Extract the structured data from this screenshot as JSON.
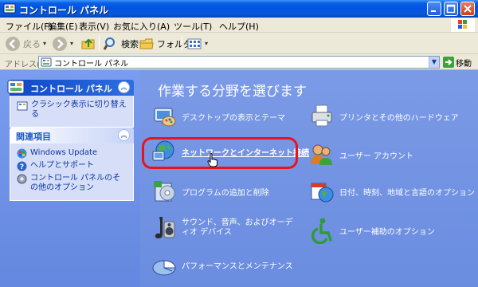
{
  "window": {
    "title": "コントロール パネル",
    "controls": [
      "minimize",
      "maximize",
      "close"
    ]
  },
  "menu": [
    "ファイル(F)",
    "編集(E)",
    "表示(V)",
    "お気に入り(A)",
    "ツール(T)",
    "ヘルプ(H)"
  ],
  "toolbar": {
    "back_label": "戻る",
    "search_label": "検索",
    "folders_label": "フォルダ"
  },
  "address": {
    "label": "アドレス(D)",
    "value": "コントロール パネル",
    "go_label": "移動"
  },
  "sidebar": {
    "panel1": {
      "title": "コントロール パネル",
      "link": "クラシック表示に切り替える"
    },
    "panel2": {
      "title": "関連項目",
      "links": [
        "Windows Update",
        "ヘルプとサポート",
        "コントロール パネルのその他のオプション"
      ]
    }
  },
  "main": {
    "heading": "作業する分野を選びます",
    "categories": [
      {
        "label": "デスクトップの表示とテーマ",
        "icon": "desktop-themes-icon"
      },
      {
        "label": "ネットワークとインターネット接続",
        "icon": "network-internet-icon",
        "highlighted": true
      },
      {
        "label": "プログラムの追加と削除",
        "icon": "add-remove-programs-icon"
      },
      {
        "label": "サウンド、音声、およびオーディオ デバイス",
        "icon": "sound-audio-icon"
      },
      {
        "label": "パフォーマンスとメンテナンス",
        "icon": "performance-maintenance-icon"
      },
      {
        "label": "プリンタとその他のハードウェア",
        "icon": "printer-hardware-icon"
      },
      {
        "label": "ユーザー アカウント",
        "icon": "user-accounts-icon"
      },
      {
        "label": "日付、時刻、地域と言語のオプション",
        "icon": "date-time-region-icon"
      },
      {
        "label": "ユーザー補助のオプション",
        "icon": "accessibility-icon"
      }
    ]
  },
  "colors": {
    "highlight": "#e8141c",
    "main_bg": "#7b9ae6",
    "titlebar": "#0054e3"
  }
}
